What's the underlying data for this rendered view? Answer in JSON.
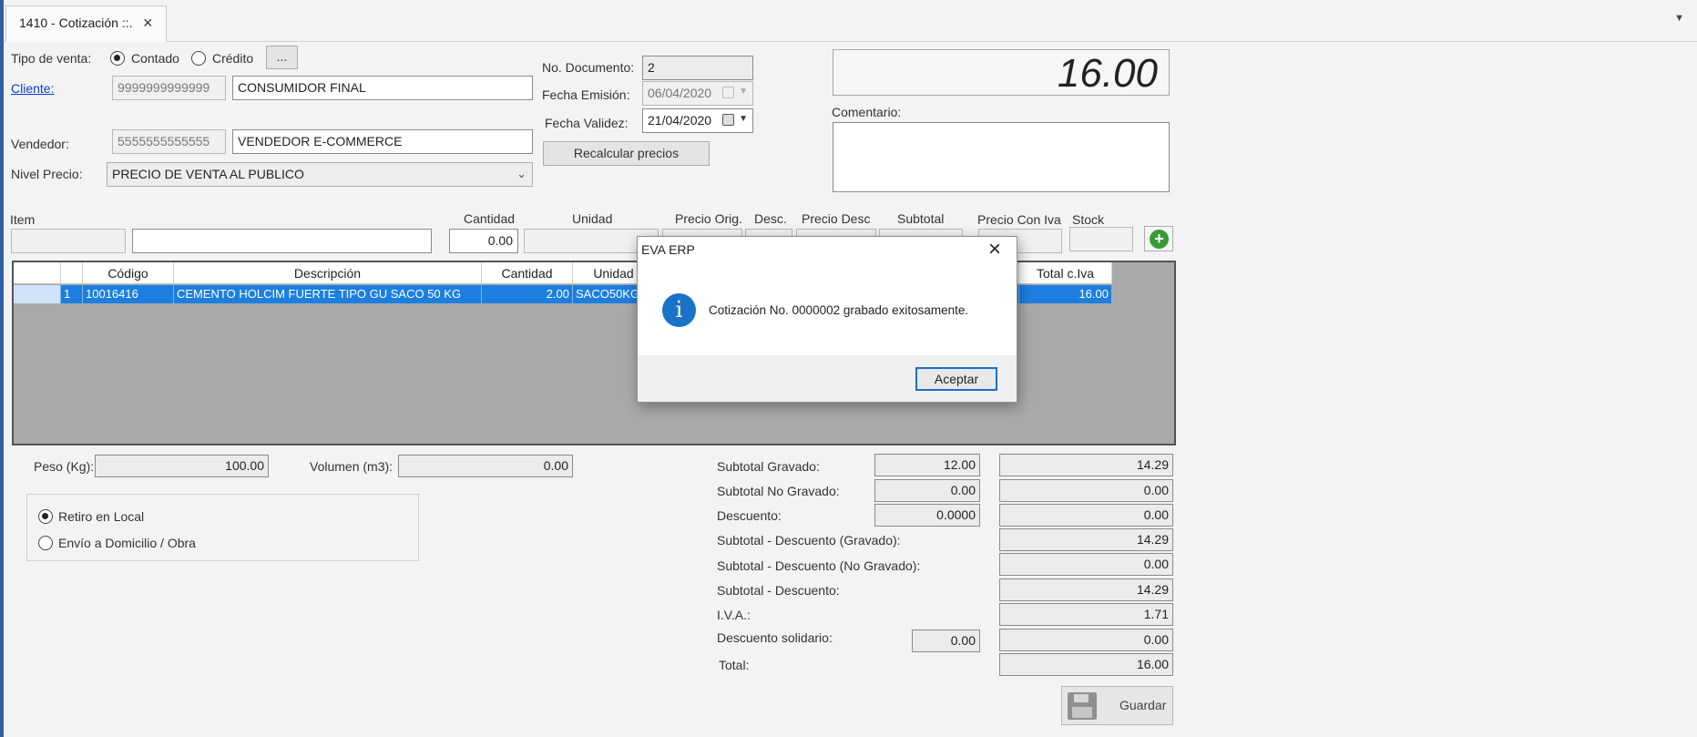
{
  "tab": {
    "title": "1410 - Cotización ::.",
    "close_icon": "close-icon"
  },
  "sale_type": {
    "label": "Tipo de venta:",
    "options": [
      "Contado",
      "Crédito"
    ],
    "selected": "Contado",
    "more_label": "..."
  },
  "client": {
    "label": "Cliente:",
    "id": "9999999999999",
    "name": "CONSUMIDOR FINAL"
  },
  "seller": {
    "label": "Vendedor:",
    "id": "5555555555555",
    "name": "VENDEDOR E-COMMERCE"
  },
  "price_level": {
    "label": "Nivel Precio:",
    "value": "PRECIO DE VENTA AL PUBLICO"
  },
  "document": {
    "number_label": "No. Documento:",
    "number": "2",
    "issue_label": "Fecha Emisión:",
    "issue_date": "06/04/2020",
    "valid_label": "Fecha Validez:",
    "valid_date": "21/04/2020",
    "recalc_label": "Recalcular precios"
  },
  "total_display": "16.00",
  "comment": {
    "label": "Comentario:",
    "value": ""
  },
  "item_entry": {
    "labels": {
      "item": "Item",
      "quantity": "Cantidad",
      "unit": "Unidad",
      "orig_price": "Precio Orig.",
      "discount": "Desc.",
      "disc_price": "Precio Desc",
      "subtotal": "Subtotal",
      "price_iva": "Precio Con Iva",
      "stock": "Stock"
    },
    "quantity_value": "0.00"
  },
  "grid": {
    "headers": [
      "Código",
      "Descripción",
      "Cantidad",
      "Unidad",
      "Total c.Iva"
    ],
    "rows": [
      {
        "n": "1",
        "code": "10016416",
        "desc": "CEMENTO HOLCIM FUERTE TIPO GU SACO 50 KG",
        "qty": "2.00",
        "unit": "SACO50KG",
        "total": "16.00"
      }
    ]
  },
  "weight": {
    "label": "Peso (Kg):",
    "value": "100.00"
  },
  "volume": {
    "label": "Volumen (m3):",
    "value": "0.00"
  },
  "delivery": {
    "options": [
      "Retiro en Local",
      "Envío a Domicilio / Obra"
    ],
    "selected": "Retiro en Local"
  },
  "totals": {
    "subtotal_gravado": {
      "label": "Subtotal Gravado:",
      "input": "12.00",
      "value": "14.29"
    },
    "subtotal_no_gravado": {
      "label": "Subtotal No Gravado:",
      "input": "0.00",
      "value": "0.00"
    },
    "descuento": {
      "label": "Descuento:",
      "input": "0.0000",
      "value": "0.00"
    },
    "sub_desc_gravado": {
      "label": "Subtotal - Descuento (Gravado):",
      "value": "14.29"
    },
    "sub_desc_no_gravado": {
      "label": "Subtotal - Descuento (No Gravado):",
      "value": "0.00"
    },
    "sub_desc": {
      "label": "Subtotal - Descuento:",
      "value": "14.29"
    },
    "iva": {
      "label": "I.V.A.:",
      "value": "1.71"
    },
    "solidario": {
      "label": "Descuento solidario:",
      "input": "0.00",
      "value": "0.00"
    },
    "total": {
      "label": "Total:",
      "value": "16.00"
    }
  },
  "save_label": "Guardar",
  "dialog": {
    "title": "EVA ERP",
    "message": "Cotización No. 0000002 grabado exitosamente.",
    "ok_label": "Aceptar"
  },
  "colors": {
    "selection": "#1c7fe0",
    "accent": "#2d5fa6",
    "info_icon": "#1a73c8"
  }
}
